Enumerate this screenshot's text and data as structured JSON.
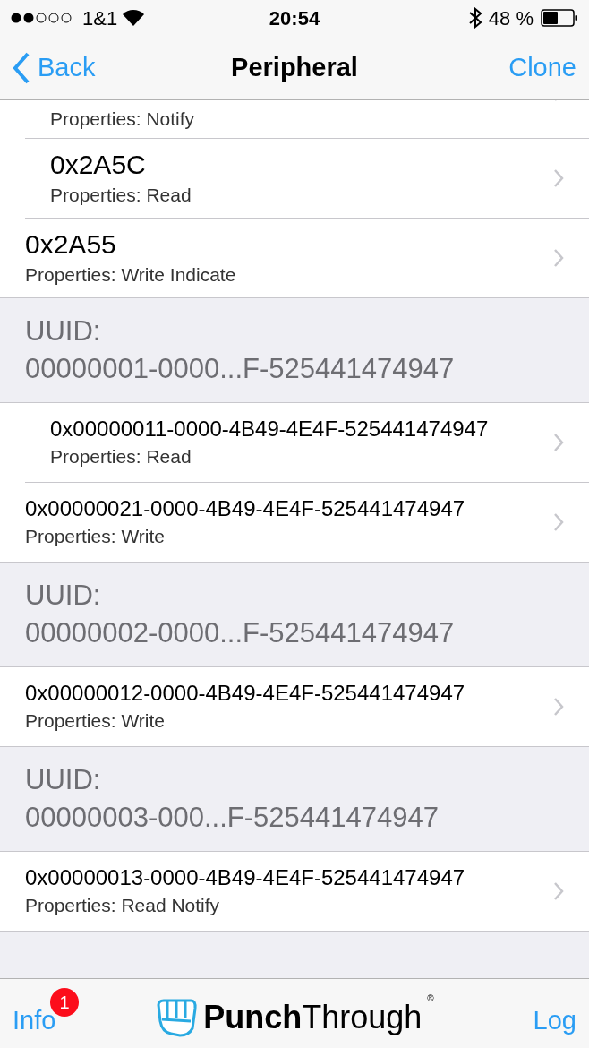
{
  "status_bar": {
    "carrier": "1&1",
    "time": "20:54",
    "battery": "48 %"
  },
  "nav": {
    "back": "Back",
    "title": "Peripheral",
    "action": "Clone"
  },
  "rows": [
    {
      "kind": "characteristic",
      "properties": "Properties: Notify"
    },
    {
      "kind": "characteristic",
      "title": "0x2A5C",
      "properties": "Properties: Read"
    },
    {
      "kind": "characteristic",
      "title": "0x2A55",
      "properties": "Properties: Write Indicate"
    },
    {
      "kind": "header",
      "label": "UUID:",
      "uuid": "00000001-0000...F-525441474947"
    },
    {
      "kind": "characteristic",
      "title": "0x00000011-0000-4B49-4E4F-525441474947",
      "properties": "Properties: Read"
    },
    {
      "kind": "characteristic",
      "title": "0x00000021-0000-4B49-4E4F-525441474947",
      "properties": "Properties: Write"
    },
    {
      "kind": "header",
      "label": "UUID:",
      "uuid": "00000002-0000...F-525441474947"
    },
    {
      "kind": "characteristic",
      "title": "0x00000012-0000-4B49-4E4F-525441474947",
      "properties": "Properties: Write"
    },
    {
      "kind": "header",
      "label": "UUID:",
      "uuid": "00000003-000...F-525441474947"
    },
    {
      "kind": "characteristic",
      "title": "0x00000013-0000-4B49-4E4F-525441474947",
      "properties": "Properties: Read Notify"
    }
  ],
  "toolbar": {
    "info": "Info",
    "badge": "1",
    "logo": "**Punch**Through",
    "registered": "®",
    "log": "Log"
  }
}
